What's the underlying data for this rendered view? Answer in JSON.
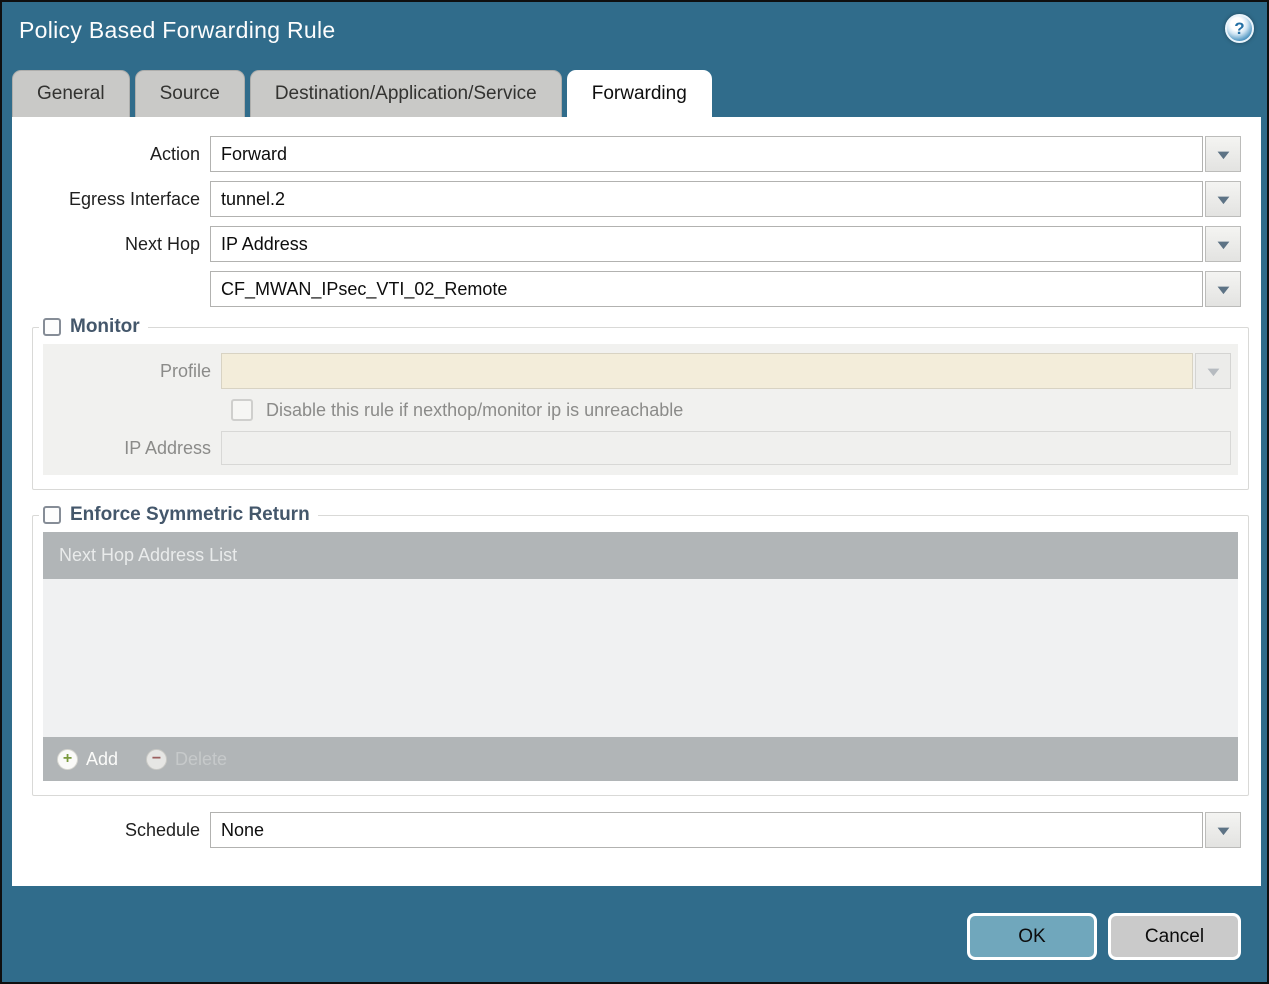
{
  "window": {
    "title": "Policy Based Forwarding Rule"
  },
  "icons": {
    "help": "?",
    "dropdown": "▼",
    "add": "+",
    "delete": "−"
  },
  "tabs": [
    {
      "label": "General",
      "active": false
    },
    {
      "label": "Source",
      "active": false
    },
    {
      "label": "Destination/Application/Service",
      "active": false
    },
    {
      "label": "Forwarding",
      "active": true
    }
  ],
  "form": {
    "action": {
      "label": "Action",
      "value": "Forward"
    },
    "egress_interface": {
      "label": "Egress Interface",
      "value": "tunnel.2"
    },
    "next_hop": {
      "label": "Next Hop",
      "value": "IP Address"
    },
    "next_hop_address": {
      "value": "CF_MWAN_IPsec_VTI_02_Remote"
    },
    "schedule": {
      "label": "Schedule",
      "value": "None"
    }
  },
  "monitor": {
    "legend": "Monitor",
    "checked": false,
    "profile": {
      "label": "Profile",
      "value": ""
    },
    "disable_rule": {
      "label": "Disable this rule if nexthop/monitor ip is unreachable",
      "checked": false
    },
    "ip_address": {
      "label": "IP Address",
      "value": ""
    }
  },
  "symmetric_return": {
    "legend": "Enforce Symmetric Return",
    "checked": false,
    "table": {
      "header": "Next Hop Address List",
      "rows": [],
      "add_label": "Add",
      "delete_label": "Delete",
      "delete_enabled": false
    }
  },
  "footer": {
    "ok_label": "OK",
    "cancel_label": "Cancel"
  },
  "colors": {
    "titlebar_bg": "#306c8b",
    "active_tab_bg": "#ffffff",
    "inactive_tab_bg": "#c9c9c7",
    "group_label": "#44576b",
    "disabled_field_bg": "#f3edda",
    "table_bar_bg": "#b1b5b7",
    "ok_button_bg": "#70a7bc",
    "cancel_button_bg": "#cacaca",
    "add_icon_green": "#7a9a3d",
    "delete_icon_red": "#9c6060"
  }
}
